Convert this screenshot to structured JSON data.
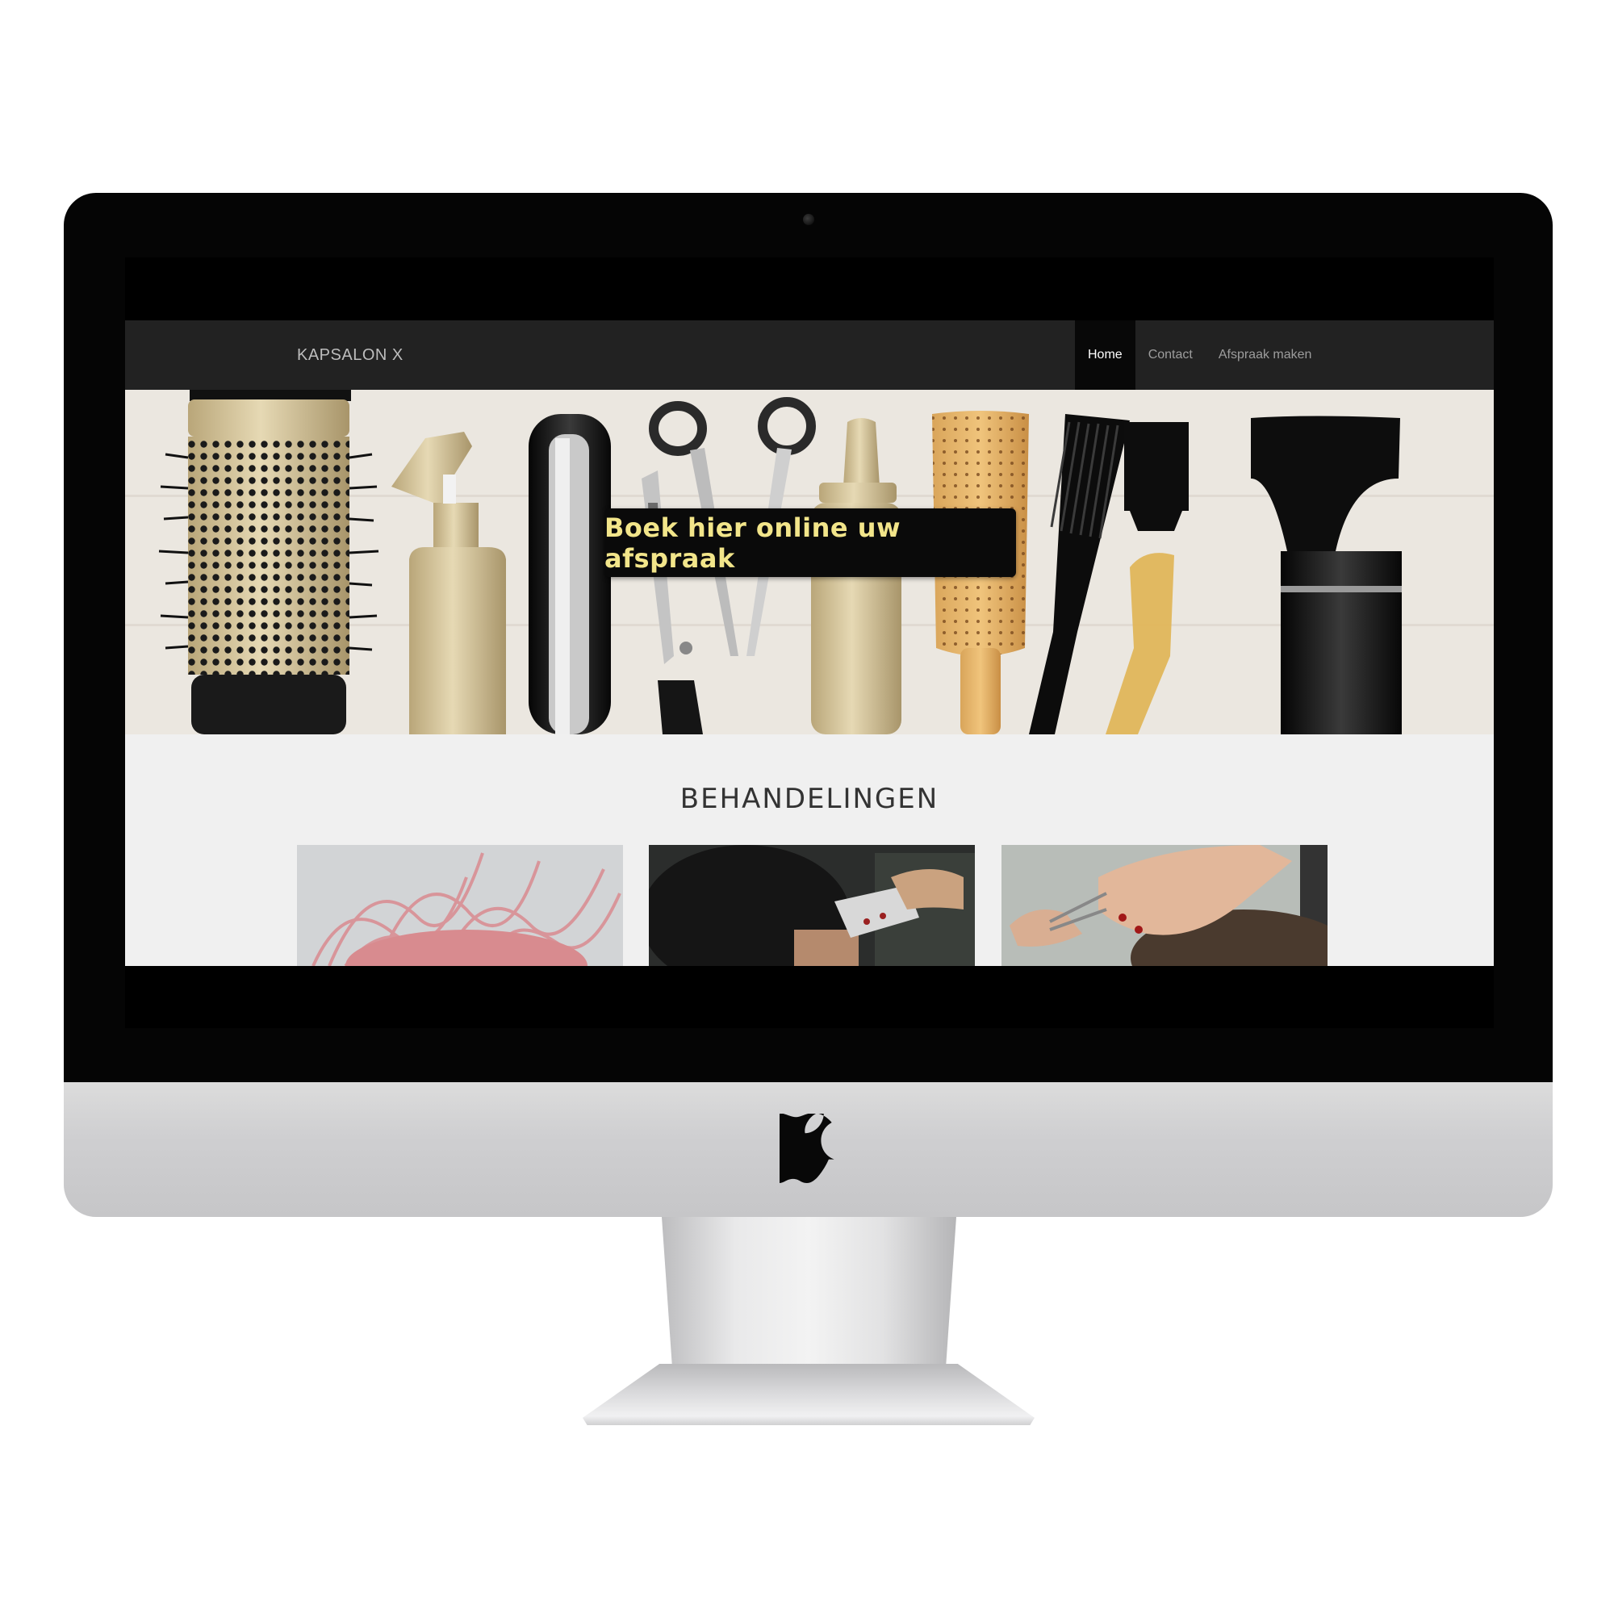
{
  "site": {
    "brand": "KAPSALON X",
    "nav": [
      {
        "label": "Home",
        "active": true
      },
      {
        "label": "Contact",
        "active": false
      },
      {
        "label": "Afspraak maken",
        "active": false
      }
    ],
    "hero": {
      "cta_label": "Boek hier online uw afspraak"
    },
    "section": {
      "title": "BEHANDELINGEN"
    }
  },
  "icons": {
    "monitor_logo": "apple-logo",
    "webcam": "camera-icon"
  },
  "colors": {
    "navbar_bg": "#222222",
    "nav_active_bg": "#080808",
    "cta_text": "#f2e58a",
    "cta_bg": "#0a0a0a",
    "content_bg": "#f0f0f0"
  }
}
